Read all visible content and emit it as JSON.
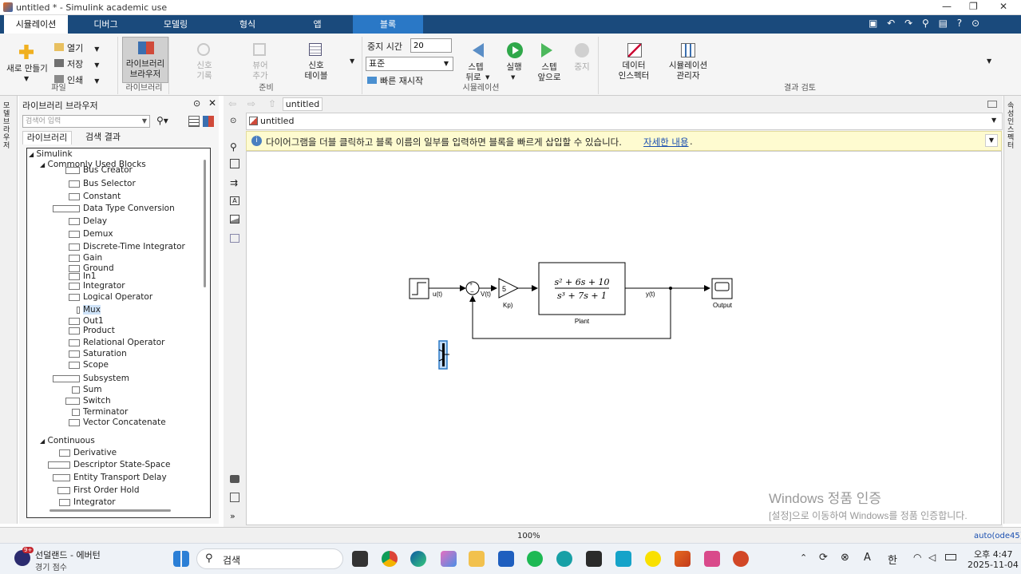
{
  "window": {
    "title": "untitled * - Simulink academic use"
  },
  "tabs": [
    "시뮬레이션",
    "디버그",
    "모델링",
    "형식",
    "앱",
    "블록"
  ],
  "ribbon": {
    "file": {
      "new_label": "새로 만들기",
      "open_label": "열기",
      "save_label": "저장",
      "print_label": "인쇄",
      "group_label": "파일"
    },
    "library": {
      "browser_label_1": "라이브러리",
      "browser_label_2": "브라우저",
      "group_label": "라이브러리"
    },
    "prepare": {
      "log_signals_1": "신호",
      "log_signals_2": "기록",
      "add_viewer_1": "뷰어",
      "add_viewer_2": "추가",
      "signal_table_1": "신호",
      "signal_table_2": "테이블",
      "group_label": "준비"
    },
    "simulation": {
      "stop_time_label": "중지 시간",
      "stop_time_value": "20",
      "mode_value": "표준",
      "fast_restart_label": "빠른 재시작",
      "step_back_1": "스텝",
      "step_back_2": "뒤로",
      "run_label": "실행",
      "step_forward_1": "스텝",
      "step_forward_2": "앞으로",
      "stop_label": "중지",
      "group_label": "시뮬레이션"
    },
    "review": {
      "data_inspector_1": "데이터",
      "data_inspector_2": "인스펙터",
      "sim_manager_1": "시뮬레이션",
      "sim_manager_2": "관리자",
      "group_label": "결과 검토"
    }
  },
  "library_browser": {
    "title": "라이브러리 브라우저",
    "search_placeholder": "검색어 입력",
    "tab_library": "라이브러리",
    "tab_search": "검색 결과",
    "root": "Simulink",
    "group1": "Commonly Used Blocks",
    "items1": [
      "Bus Creator",
      "Bus Selector",
      "Constant",
      "Data Type Conversion",
      "Delay",
      "Demux",
      "Discrete-Time Integrator",
      "Gain",
      "Ground",
      "In1",
      "Integrator",
      "Logical Operator",
      "Mux",
      "Out1",
      "Product",
      "Relational Operator",
      "Saturation",
      "Scope",
      "Subsystem",
      "Sum",
      "Switch",
      "Terminator",
      "Vector Concatenate"
    ],
    "group2": "Continuous",
    "items2": [
      "Derivative",
      "Descriptor State-Space",
      "Entity Transport Delay",
      "First Order Hold",
      "Integrator"
    ]
  },
  "side_left_label": "모델 브라우저",
  "side_right_label": "속성 인스펙터",
  "editor": {
    "tab_label": "untitled",
    "breadcrumb": "untitled",
    "info_text": "다이어그램을 더블 클릭하고 블록 이름의 일부를 입력하면 블록을 빠르게 삽입할 수 있습니다.",
    "info_link": "자세한 내용"
  },
  "diagram": {
    "u_label": "u(t)",
    "v_label": "V(t)",
    "gain_value": "5",
    "gain_name": "Kp)",
    "tf_num": "s² + 6s + 10",
    "tf_den": "s³ + 7s + 1",
    "plant_name": "Plant",
    "y_label": "y(t)",
    "output_name": "Output"
  },
  "watermark": {
    "line1": "Windows 정품 인증",
    "line2": "[설정]으로 이동하여 Windows를 정품 인증합니다."
  },
  "status": {
    "zoom": "100%",
    "solver": "auto(ode45)"
  },
  "taskbar": {
    "weather_badge": "9+",
    "weather_title": "선덜랜드 - 에버턴",
    "weather_sub": "경기 점수",
    "search_label": "검색",
    "time": "오후 4:47",
    "date": "2025-11-04",
    "ime_a": "A",
    "ime_han": "한"
  }
}
